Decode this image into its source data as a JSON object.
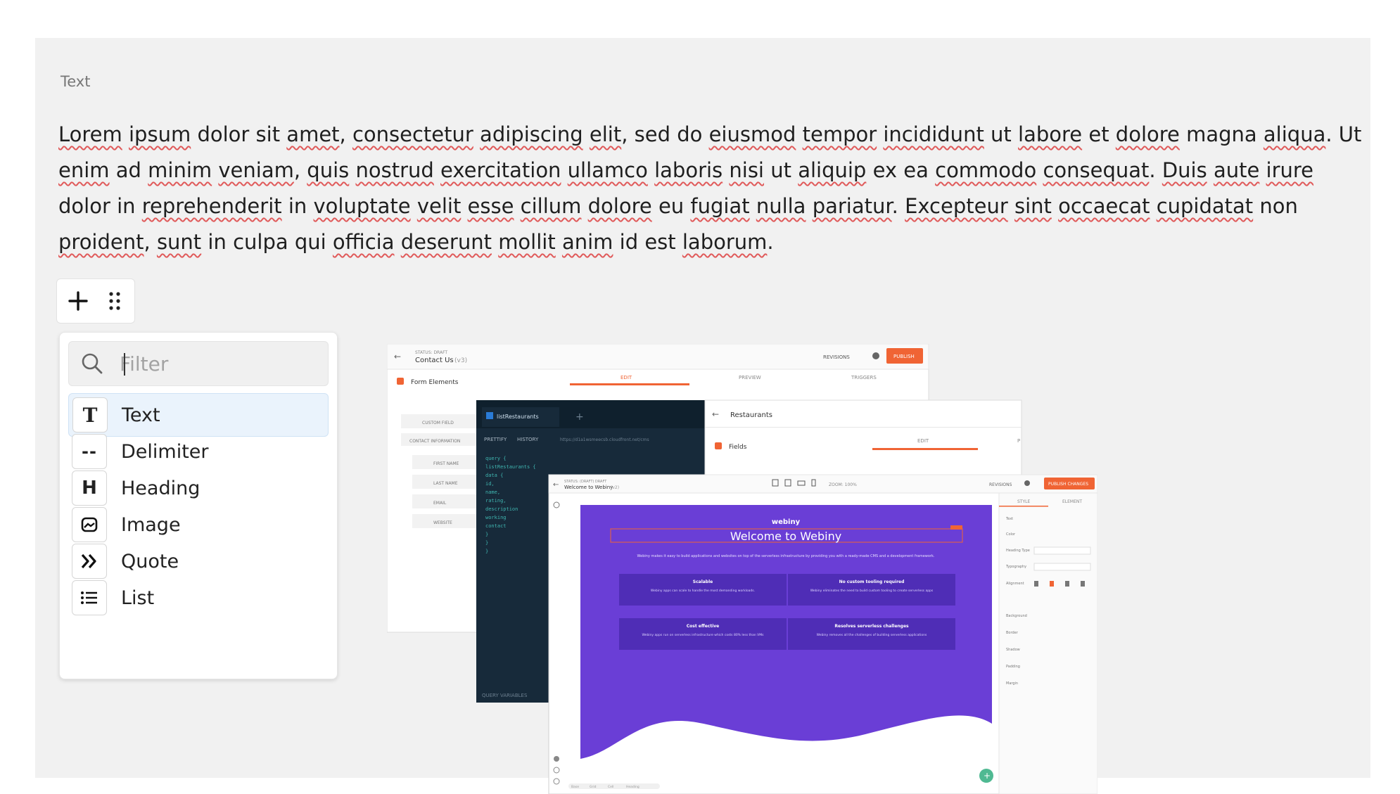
{
  "block": {
    "label": "Text",
    "paragraph": "Lorem ipsum dolor sit amet, consectetur adipiscing elit, sed do eiusmod tempor incididunt ut labore et dolore magna aliqua. Ut enim ad minim veniam, quis nostrud exercitation ullamco laboris nisi ut aliquip ex ea commodo consequat. Duis aute irure dolor in reprehenderit in voluptate velit esse cillum dolore eu fugiat nulla pariatur. Excepteur sint occaecat cupidatat non proident, sunt in culpa qui officia deserunt mollit anim id est laborum."
  },
  "toolbar": {
    "add_icon": "plus-icon",
    "drag_icon": "drag-handle-icon"
  },
  "menu": {
    "filter_placeholder": "Filter",
    "items": [
      {
        "label": "Text",
        "icon": "text-icon",
        "glyph": "T",
        "active": true
      },
      {
        "label": "Delimiter",
        "icon": "delimiter-icon",
        "glyph": "--"
      },
      {
        "label": "Heading",
        "icon": "heading-icon",
        "glyph": "H"
      },
      {
        "label": "Image",
        "icon": "image-icon",
        "glyph": ""
      },
      {
        "label": "Quote",
        "icon": "quote-icon",
        "glyph": "»"
      },
      {
        "label": "List",
        "icon": "list-icon",
        "glyph": ""
      }
    ]
  },
  "image": {
    "back_window": {
      "status": "STATUS: DRAFT",
      "title": "Contact Us",
      "version": "(v3)",
      "revisions": "REVISIONS",
      "publish": "PUBLISH",
      "section": "Form Elements",
      "tabs": [
        "EDIT",
        "PREVIEW",
        "TRIGGERS"
      ],
      "fields": [
        "CUSTOM FIELD",
        "CONTACT INFORMATION",
        "FIRST NAME",
        "LAST NAME",
        "EMAIL",
        "WEBSITE"
      ]
    },
    "graphql_window": {
      "tab": "listRestaurants",
      "toolbar": [
        "PRETTIFY",
        "HISTORY"
      ],
      "url": "https://d1a1wsmeecsb.cloudfront.net/cms",
      "code": [
        "query {",
        "  listRestaurants {",
        "    data {",
        "      id,",
        "      name,",
        "      rating,",
        "      description",
        "      working",
        "      contact",
        "    }",
        "  }",
        "}"
      ],
      "footer": "QUERY VARIABLES"
    },
    "restaurants_window": {
      "title": "Restaurants",
      "section": "Fields",
      "tabs": [
        "EDIT",
        "P"
      ]
    },
    "page_builder": {
      "status": "STATUS: (DRAFT) DRAFT",
      "title": "Welcome to Webiny",
      "version": "(v2)",
      "zoom": "ZOOM: 100%",
      "revisions": "REVISIONS",
      "publish": "PUBLISH CHANGES",
      "logo": "webiny",
      "heading": "Welcome to Webiny",
      "intro": "Webiny makes it easy to build applications and websites on top of the serverless infrastructure by providing you with a ready-made CMS and a development framework.",
      "features": [
        {
          "title": "Scalable",
          "text": "Webiny apps can scale to handle the most demanding workloads."
        },
        {
          "title": "No custom tooling required",
          "text": "Webiny eliminates the need to build custom tooling to create serverless apps"
        },
        {
          "title": "Cost effective",
          "text": "Webiny apps run on serverless infrastructure which costs 80% less than VMs"
        },
        {
          "title": "Resolves serverless challenges",
          "text": "Webiny removes all the challenges of building serverless applications"
        }
      ],
      "side_tabs": [
        "STYLE",
        "ELEMENT"
      ],
      "side_items": [
        "Text",
        "Color",
        "Heading Type",
        "Typography",
        "Alignment",
        "Background",
        "Border",
        "Shadow",
        "Padding",
        "Margin"
      ],
      "bottom": [
        "Base",
        "Grid",
        "Cell",
        "Heading"
      ]
    }
  }
}
